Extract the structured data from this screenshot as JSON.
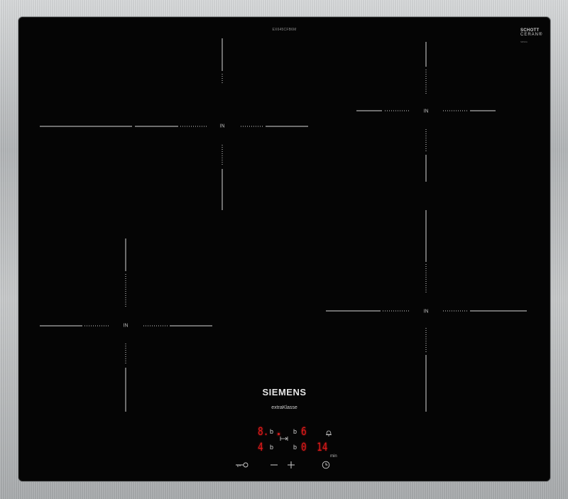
{
  "hob": {
    "model_number": "EX645CFB6M",
    "cooktop_brand": {
      "line1": "SCHOTT",
      "line2": "CERAN®",
      "line3": "SRS9A"
    },
    "zones": [
      {
        "label": "IN"
      },
      {
        "label": "IN"
      },
      {
        "label": "IN"
      },
      {
        "label": "IN"
      }
    ],
    "brand": "SIEMENS",
    "series": {
      "prefix": "extra",
      "suffix": "Klasse"
    }
  },
  "display": {
    "zone_front_left_level": "8.",
    "zone_rear_left_level": "4",
    "zone_left_b1": "b",
    "zone_left_b2": "b",
    "zone_right_b1": "b",
    "zone_right_b2": "b",
    "zone_right_level": "6",
    "timer_zone": "0",
    "timer_minutes": "14",
    "timer_unit": "min"
  },
  "controls": {
    "lock_icon": "key-lock-icon",
    "minus_icon": "minus-icon",
    "plus_icon": "plus-icon",
    "timer_icon": "clock-icon",
    "alarm_icon": "bell-icon",
    "select_icon": "zone-select-icon"
  },
  "colors": {
    "glass": "#050505",
    "display_red": "#e01a1a",
    "marking": "#d0d0d0"
  }
}
